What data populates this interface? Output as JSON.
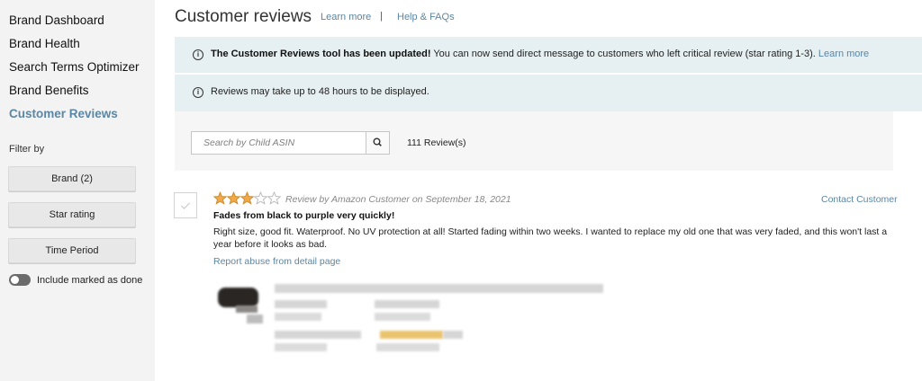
{
  "sidebar": {
    "items": [
      {
        "label": "Brand Dashboard"
      },
      {
        "label": "Brand Health"
      },
      {
        "label": "Search Terms Optimizer"
      },
      {
        "label": "Brand Benefits"
      },
      {
        "label": "Customer Reviews"
      }
    ],
    "filter_label": "Filter by",
    "filters": [
      {
        "label": "Brand (2)"
      },
      {
        "label": "Star rating"
      },
      {
        "label": "Time Period"
      }
    ],
    "toggle_label": "Include marked as done"
  },
  "header": {
    "title": "Customer reviews",
    "learn_more": "Learn more",
    "separator": "|",
    "help": "Help & FAQs"
  },
  "banner_update": {
    "bold": "The Customer Reviews tool has been updated!",
    "text": " You can now send direct message to customers who left critical review (star rating 1-3). ",
    "link": "Learn more"
  },
  "banner_delay": {
    "text": "Reviews may take up to 48 hours to be displayed."
  },
  "search": {
    "placeholder": "Search by Child ASIN",
    "count": "111 Review(s)"
  },
  "review": {
    "rating": 3,
    "max_rating": 5,
    "star_color": "#f3a847",
    "meta": "Review by Amazon Customer on September 18, 2021",
    "contact": "Contact Customer",
    "title": "Fades from black to purple very quickly!",
    "body": "Right size, good fit. Waterproof. No UV protection at all! Started fading within two weeks. I wanted to replace my old one that was very faded, and this won't last a year before it looks as bad.",
    "report": "Report abuse from detail page"
  },
  "colors": {
    "accent": "#5b86a4",
    "banner_bg": "#e6eff1",
    "sidebar_bg": "#f3f3f3"
  }
}
